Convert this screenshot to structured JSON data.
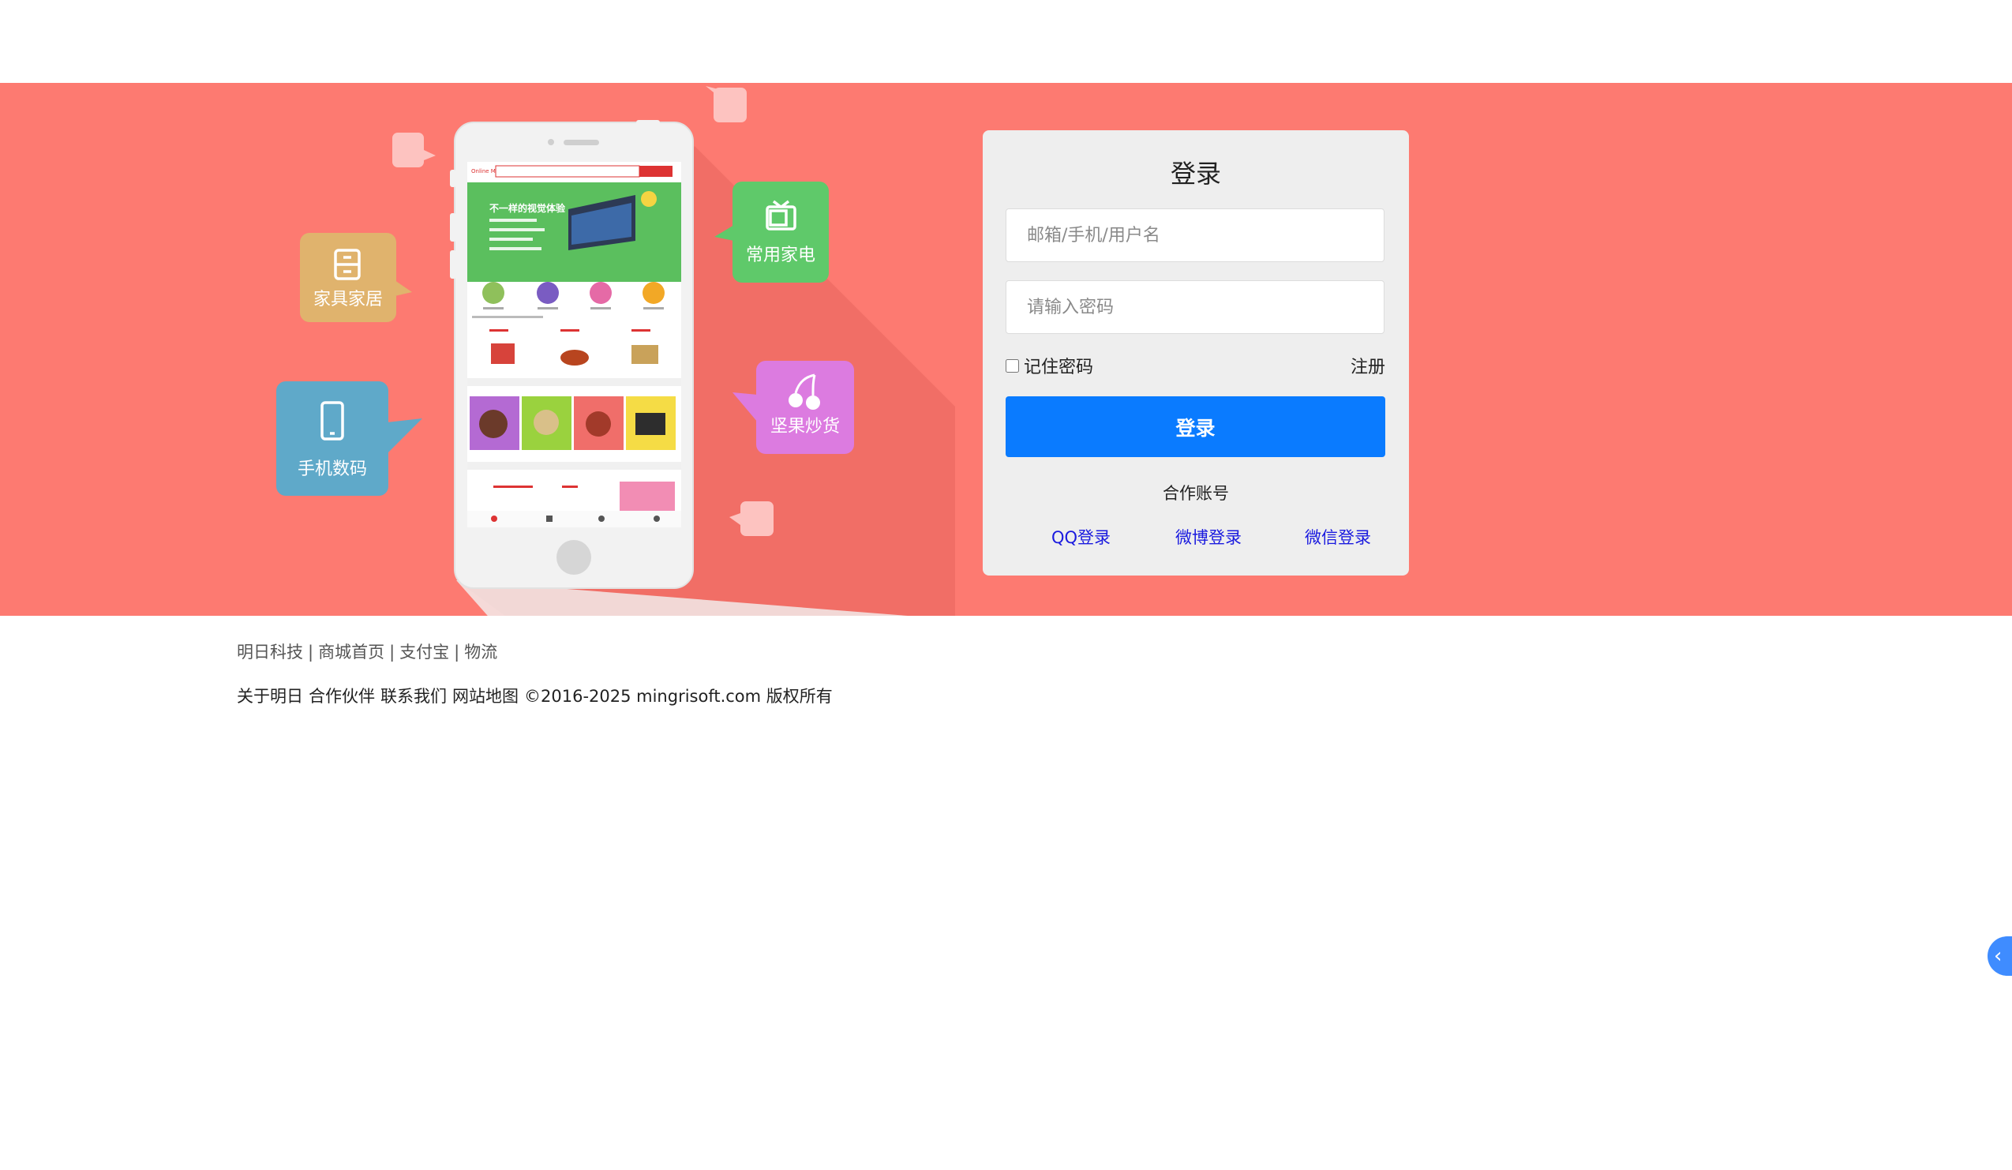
{
  "login": {
    "title": "登录",
    "username_placeholder": "邮箱/手机/用户名",
    "password_placeholder": "请输入密码",
    "remember_label": "记住密码",
    "register_label": "注册",
    "submit_label": "登录",
    "partner_title": "合作账号",
    "qq_label": "QQ登录",
    "weibo_label": "微博登录",
    "wechat_label": "微信登录"
  },
  "illustration": {
    "categories": {
      "furniture": "家具家居",
      "digital": "手机数码",
      "appliance": "常用家电",
      "snacks": "坚果炒货"
    },
    "phone_banner_text": "不一样的视觉体验"
  },
  "footer": {
    "links": [
      "明日科技",
      "商城首页",
      "支付宝",
      "物流"
    ],
    "bottom_items": [
      "关于明日",
      "合作伙伴",
      "联系我们",
      "网站地图"
    ],
    "copyright": "©2016-2025 mingrisoft.com 版权所有"
  },
  "colors": {
    "banner": "#fd7a71",
    "primary_button": "#0a7bff",
    "card": "#eeeeee",
    "furniture_bubble": "#e0b36d",
    "digital_bubble": "#5fa9c9",
    "appliance_bubble": "#5fc96a",
    "snacks_bubble": "#dc7be0"
  },
  "icons": [
    "drawer-icon",
    "mobile-phone-icon",
    "tv-icon",
    "cherry-icon",
    "chevron-left-icon"
  ]
}
